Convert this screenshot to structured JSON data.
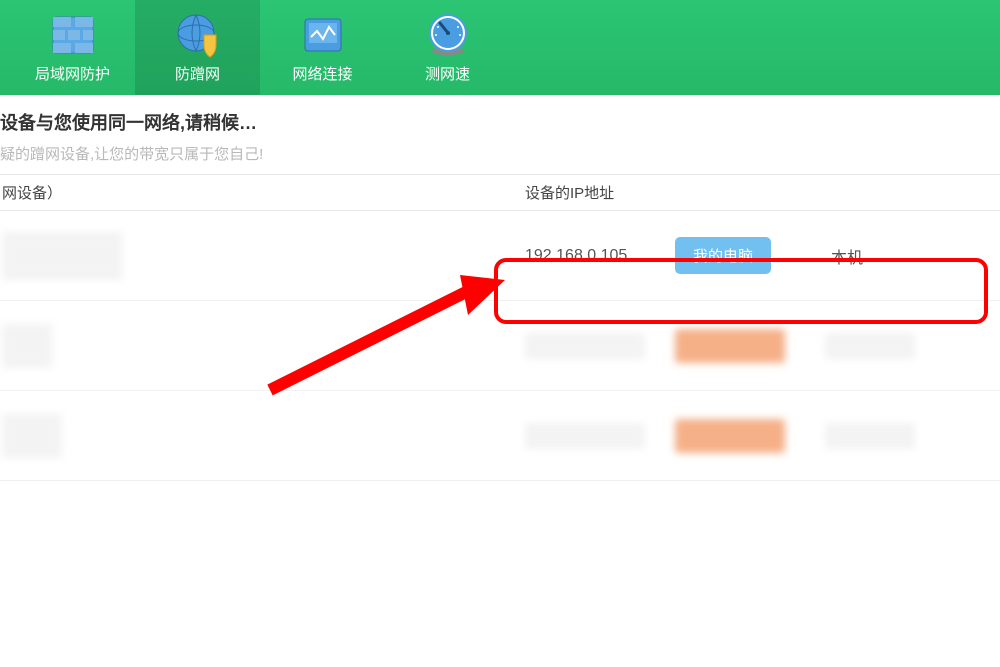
{
  "nav": {
    "items": [
      {
        "label": "局域网防护"
      },
      {
        "label": "防蹭网"
      },
      {
        "label": "网络连接"
      },
      {
        "label": "测网速"
      }
    ]
  },
  "status": {
    "title": "设备与您使用同一网络,请稍候…",
    "subtitle": "疑的蹭网设备,让您的带宽只属于您自己!"
  },
  "table": {
    "header_device": "网设备）",
    "header_ip": "设备的IP地址"
  },
  "row1": {
    "ip": "192.168.0.105",
    "button": "我的电脑",
    "local": "本机"
  }
}
